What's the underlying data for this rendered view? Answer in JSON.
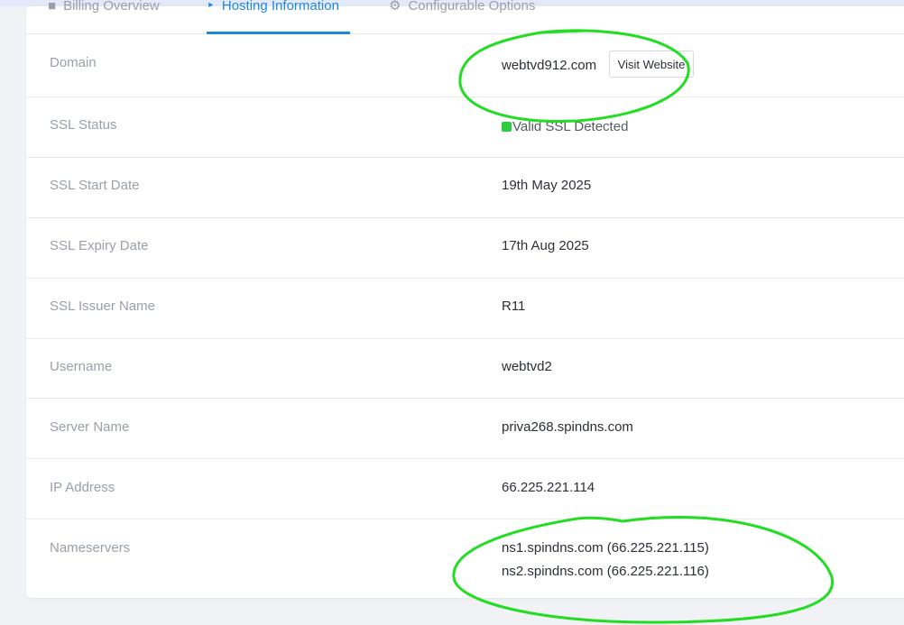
{
  "tabs": [
    {
      "label": "Billing Overview",
      "icon": "billing-icon"
    },
    {
      "label": "Hosting Information",
      "icon": "hosting-icon"
    },
    {
      "label": "Configurable Options",
      "icon": "configurable-options-icon"
    }
  ],
  "rows": {
    "domain": {
      "label": "Domain",
      "value": "webtvd912.com",
      "button": "Visit Website"
    },
    "ssl_status": {
      "label": "SSL Status",
      "value": "Valid SSL Detected"
    },
    "ssl_start": {
      "label": "SSL Start Date",
      "value": "19th May 2025"
    },
    "ssl_expiry": {
      "label": "SSL Expiry Date",
      "value": "17th Aug 2025"
    },
    "ssl_issuer": {
      "label": "SSL Issuer Name",
      "value": "R11"
    },
    "username": {
      "label": "Username",
      "value": "webtvd2"
    },
    "server": {
      "label": "Server Name",
      "value": "priva268.spindns.com"
    },
    "ip": {
      "label": "IP Address",
      "value": "66.225.221.114"
    },
    "nameservers": {
      "label": "Nameservers",
      "values": [
        "ns1.spindns.com (66.225.221.115)",
        "ns2.spindns.com (66.225.221.116)"
      ]
    }
  },
  "colors": {
    "accent": "#1e88e5",
    "ssl_ok": "#2ecc40",
    "annotation": "#22dd22"
  }
}
